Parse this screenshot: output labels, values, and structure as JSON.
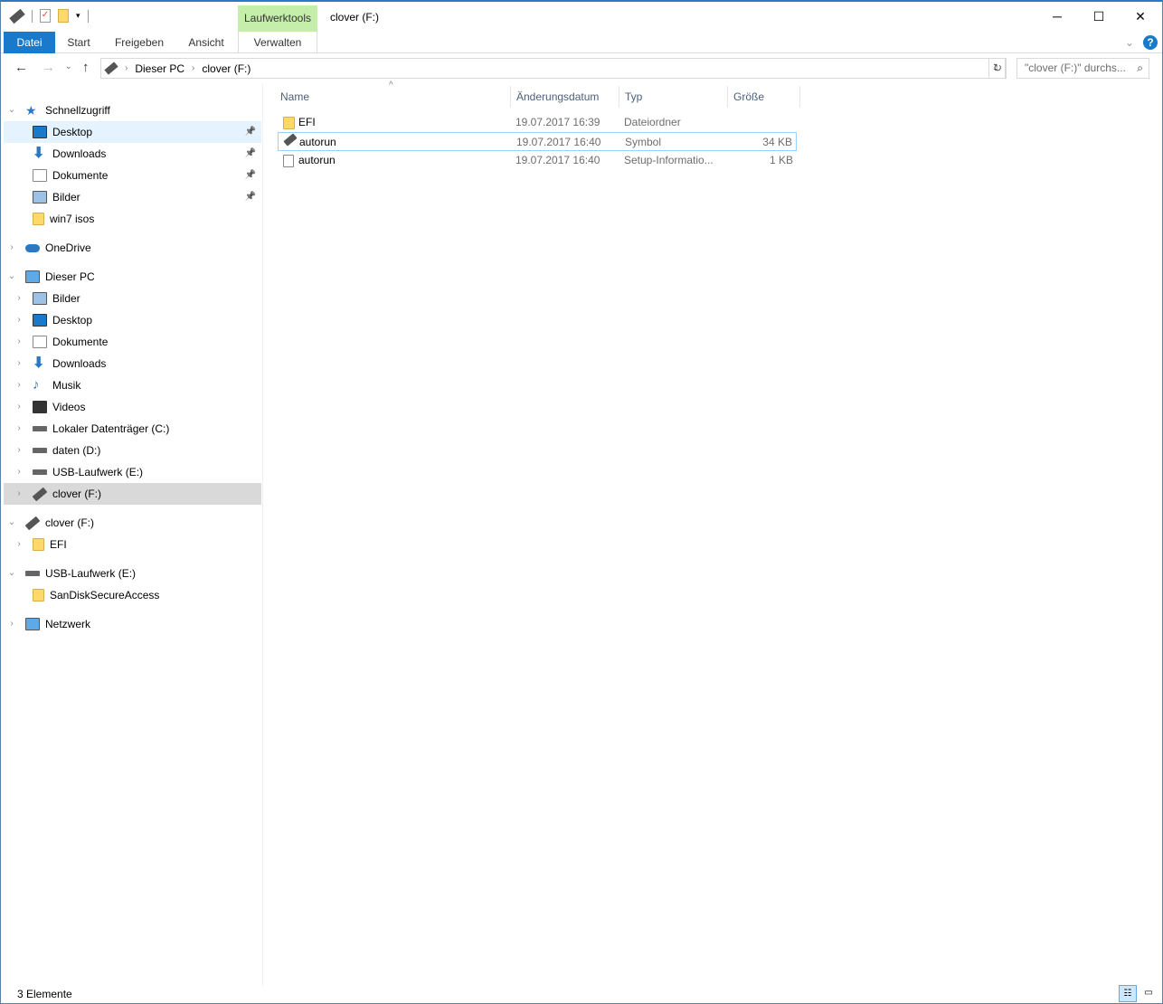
{
  "window": {
    "title": "clover (F:)",
    "context_tab": "Laufwerktools",
    "min": "─",
    "max": "☐",
    "close": "✕"
  },
  "ribbon": {
    "tabs": [
      "Datei",
      "Start",
      "Freigeben",
      "Ansicht",
      "Verwalten"
    ],
    "help": "?",
    "expand": "⌄"
  },
  "address": {
    "crumbs": [
      "Dieser PC",
      "clover (F:)"
    ],
    "search_placeholder": "\"clover (F:)\" durchs..."
  },
  "sidebar": [
    {
      "label": "Schnellzugriff",
      "level": 0,
      "icon": "star",
      "chev": "open"
    },
    {
      "label": "Desktop",
      "level": 1,
      "icon": "desktop",
      "pin": true,
      "state": "hover"
    },
    {
      "label": "Downloads",
      "level": 1,
      "icon": "download",
      "pin": true
    },
    {
      "label": "Dokumente",
      "level": 1,
      "icon": "doc",
      "pin": true
    },
    {
      "label": "Bilder",
      "level": 1,
      "icon": "pictures",
      "pin": true
    },
    {
      "label": "win7 isos",
      "level": 1,
      "icon": "folder"
    },
    {
      "label": "OneDrive",
      "level": 0,
      "icon": "cloud",
      "chev": "closed",
      "gap": true
    },
    {
      "label": "Dieser PC",
      "level": 0,
      "icon": "pc",
      "chev": "open",
      "gap": true
    },
    {
      "label": "Bilder",
      "level": 1,
      "icon": "pictures",
      "chev": "closed"
    },
    {
      "label": "Desktop",
      "level": 1,
      "icon": "desktop",
      "chev": "closed"
    },
    {
      "label": "Dokumente",
      "level": 1,
      "icon": "doc",
      "chev": "closed"
    },
    {
      "label": "Downloads",
      "level": 1,
      "icon": "download",
      "chev": "closed"
    },
    {
      "label": "Musik",
      "level": 1,
      "icon": "music",
      "chev": "closed"
    },
    {
      "label": "Videos",
      "level": 1,
      "icon": "video",
      "chev": "closed"
    },
    {
      "label": "Lokaler Datenträger (C:)",
      "level": 1,
      "icon": "drive",
      "chev": "closed"
    },
    {
      "label": "daten (D:)",
      "level": 1,
      "icon": "drive",
      "chev": "closed"
    },
    {
      "label": "USB-Laufwerk (E:)",
      "level": 1,
      "icon": "drive",
      "chev": "closed"
    },
    {
      "label": "clover (F:)",
      "level": 1,
      "icon": "usb",
      "chev": "closed",
      "state": "selected"
    },
    {
      "label": "clover (F:)",
      "level": 0,
      "icon": "usb",
      "chev": "open",
      "gap": true
    },
    {
      "label": "EFI",
      "level": 1,
      "icon": "folder",
      "chev": "closed"
    },
    {
      "label": "USB-Laufwerk (E:)",
      "level": 0,
      "icon": "drive",
      "chev": "open",
      "gap": true
    },
    {
      "label": "SanDiskSecureAccess",
      "level": 1,
      "icon": "folder"
    },
    {
      "label": "Netzwerk",
      "level": 0,
      "icon": "network",
      "chev": "closed",
      "gap": true
    }
  ],
  "columns": [
    "Name",
    "Änderungsdatum",
    "Typ",
    "Größe"
  ],
  "files": [
    {
      "name": "EFI",
      "date": "19.07.2017 16:39",
      "type": "Dateiordner",
      "size": "",
      "icon": "folder"
    },
    {
      "name": "autorun",
      "date": "19.07.2017 16:40",
      "type": "Symbol",
      "size": "34 KB",
      "icon": "usb",
      "focus": true
    },
    {
      "name": "autorun",
      "date": "19.07.2017 16:40",
      "type": "Setup-Informatio...",
      "size": "1 KB",
      "icon": "inf"
    }
  ],
  "status": "3 Elemente",
  "colors": {
    "accent": "#1979ca",
    "context": "#c5eeaa",
    "folder": "#ffd86b"
  }
}
